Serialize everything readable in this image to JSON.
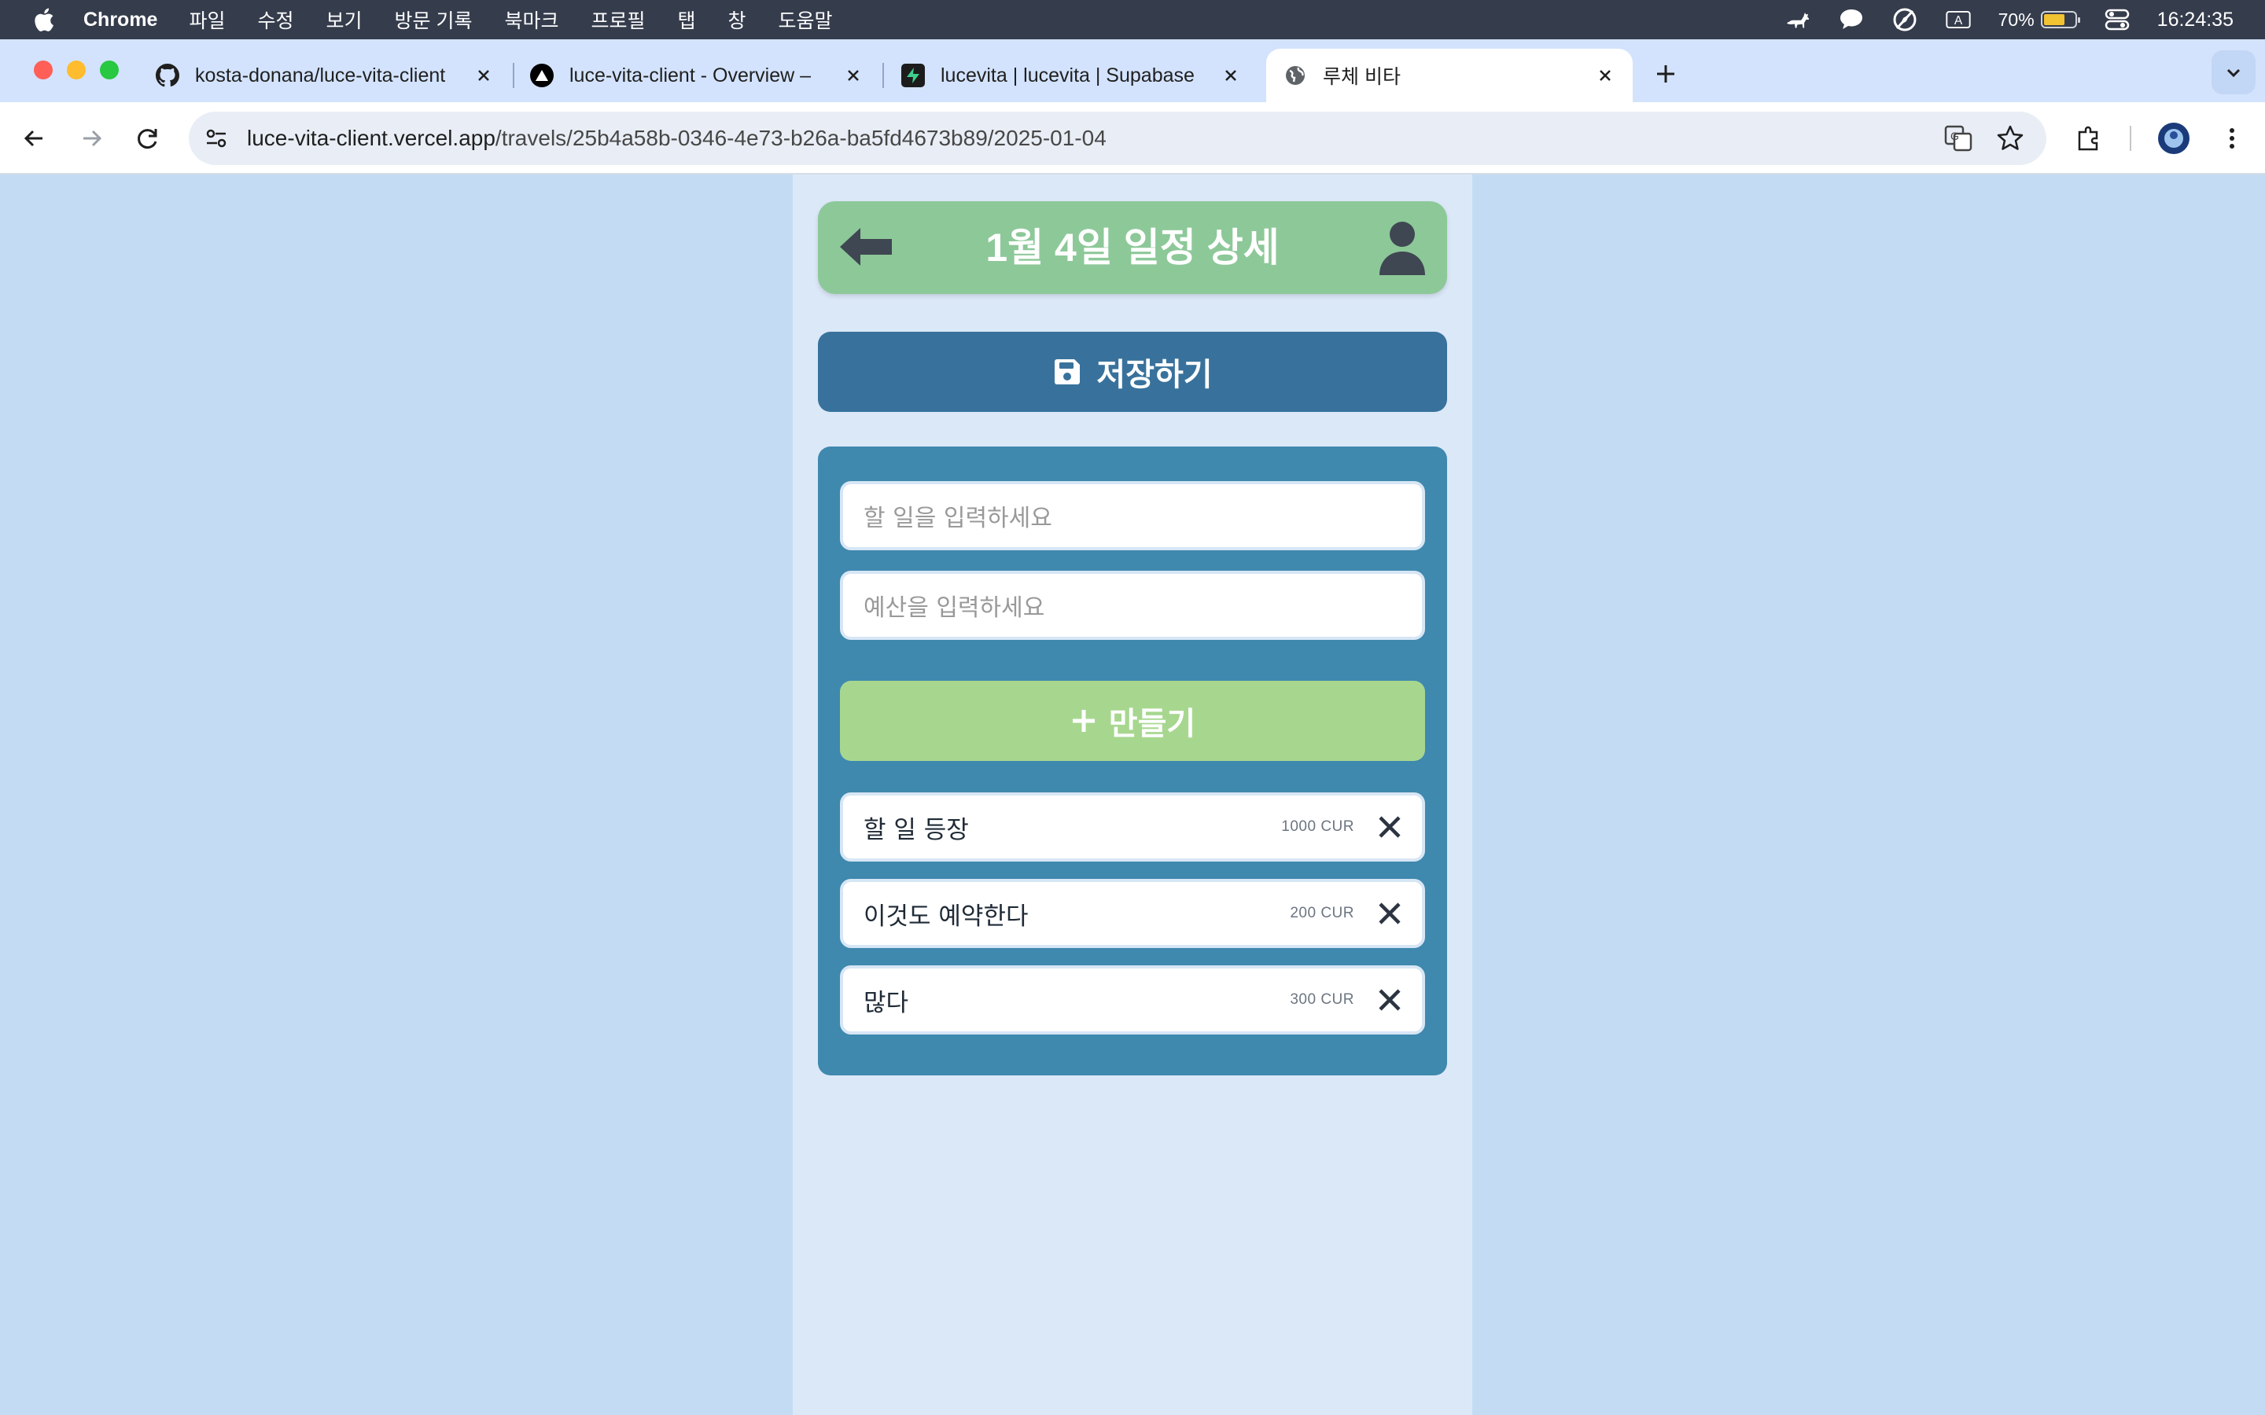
{
  "menubar": {
    "app_name": "Chrome",
    "items": [
      "파일",
      "수정",
      "보기",
      "방문 기록",
      "북마크",
      "프로필",
      "탭",
      "창",
      "도움말"
    ],
    "battery_percent_label": "70%",
    "battery_level": 0.7,
    "clock": "16:24:35",
    "input_source": "A"
  },
  "tabs": [
    {
      "title": "kosta-donana/luce-vita-client",
      "icon": "github-icon",
      "active": false
    },
    {
      "title": "luce-vita-client - Overview – ",
      "icon": "vercel-icon",
      "active": false
    },
    {
      "title": "lucevita | lucevita | Supabase",
      "icon": "supabase-icon",
      "active": false
    },
    {
      "title": "루체 비타",
      "icon": "globe-icon",
      "active": true
    }
  ],
  "address_bar": {
    "host": "luce-vita-client.vercel.app",
    "path": "/travels/25b4a58b-0346-4e73-b26a-ba5fd4673b89/2025-01-04"
  },
  "header": {
    "title": "1월 4일 일정 상세"
  },
  "save_button": {
    "label": "저장하기"
  },
  "form": {
    "todo_placeholder": "할 일을 입력하세요",
    "budget_placeholder": "예산을 입력하세요",
    "create_label": "만들기"
  },
  "todos": [
    {
      "title": "할 일 등장",
      "budget": "1000 CUR"
    },
    {
      "title": "이것도 예약한다",
      "budget": "200 CUR"
    },
    {
      "title": "많다",
      "budget": "300 CUR"
    }
  ],
  "colors": {
    "page_bg": "#c4dcf3",
    "column_bg": "#dbe8f8",
    "header_green": "#8dc899",
    "save_blue": "#38729c",
    "panel_blue": "#3f88ae",
    "create_green": "#a7d78f"
  }
}
